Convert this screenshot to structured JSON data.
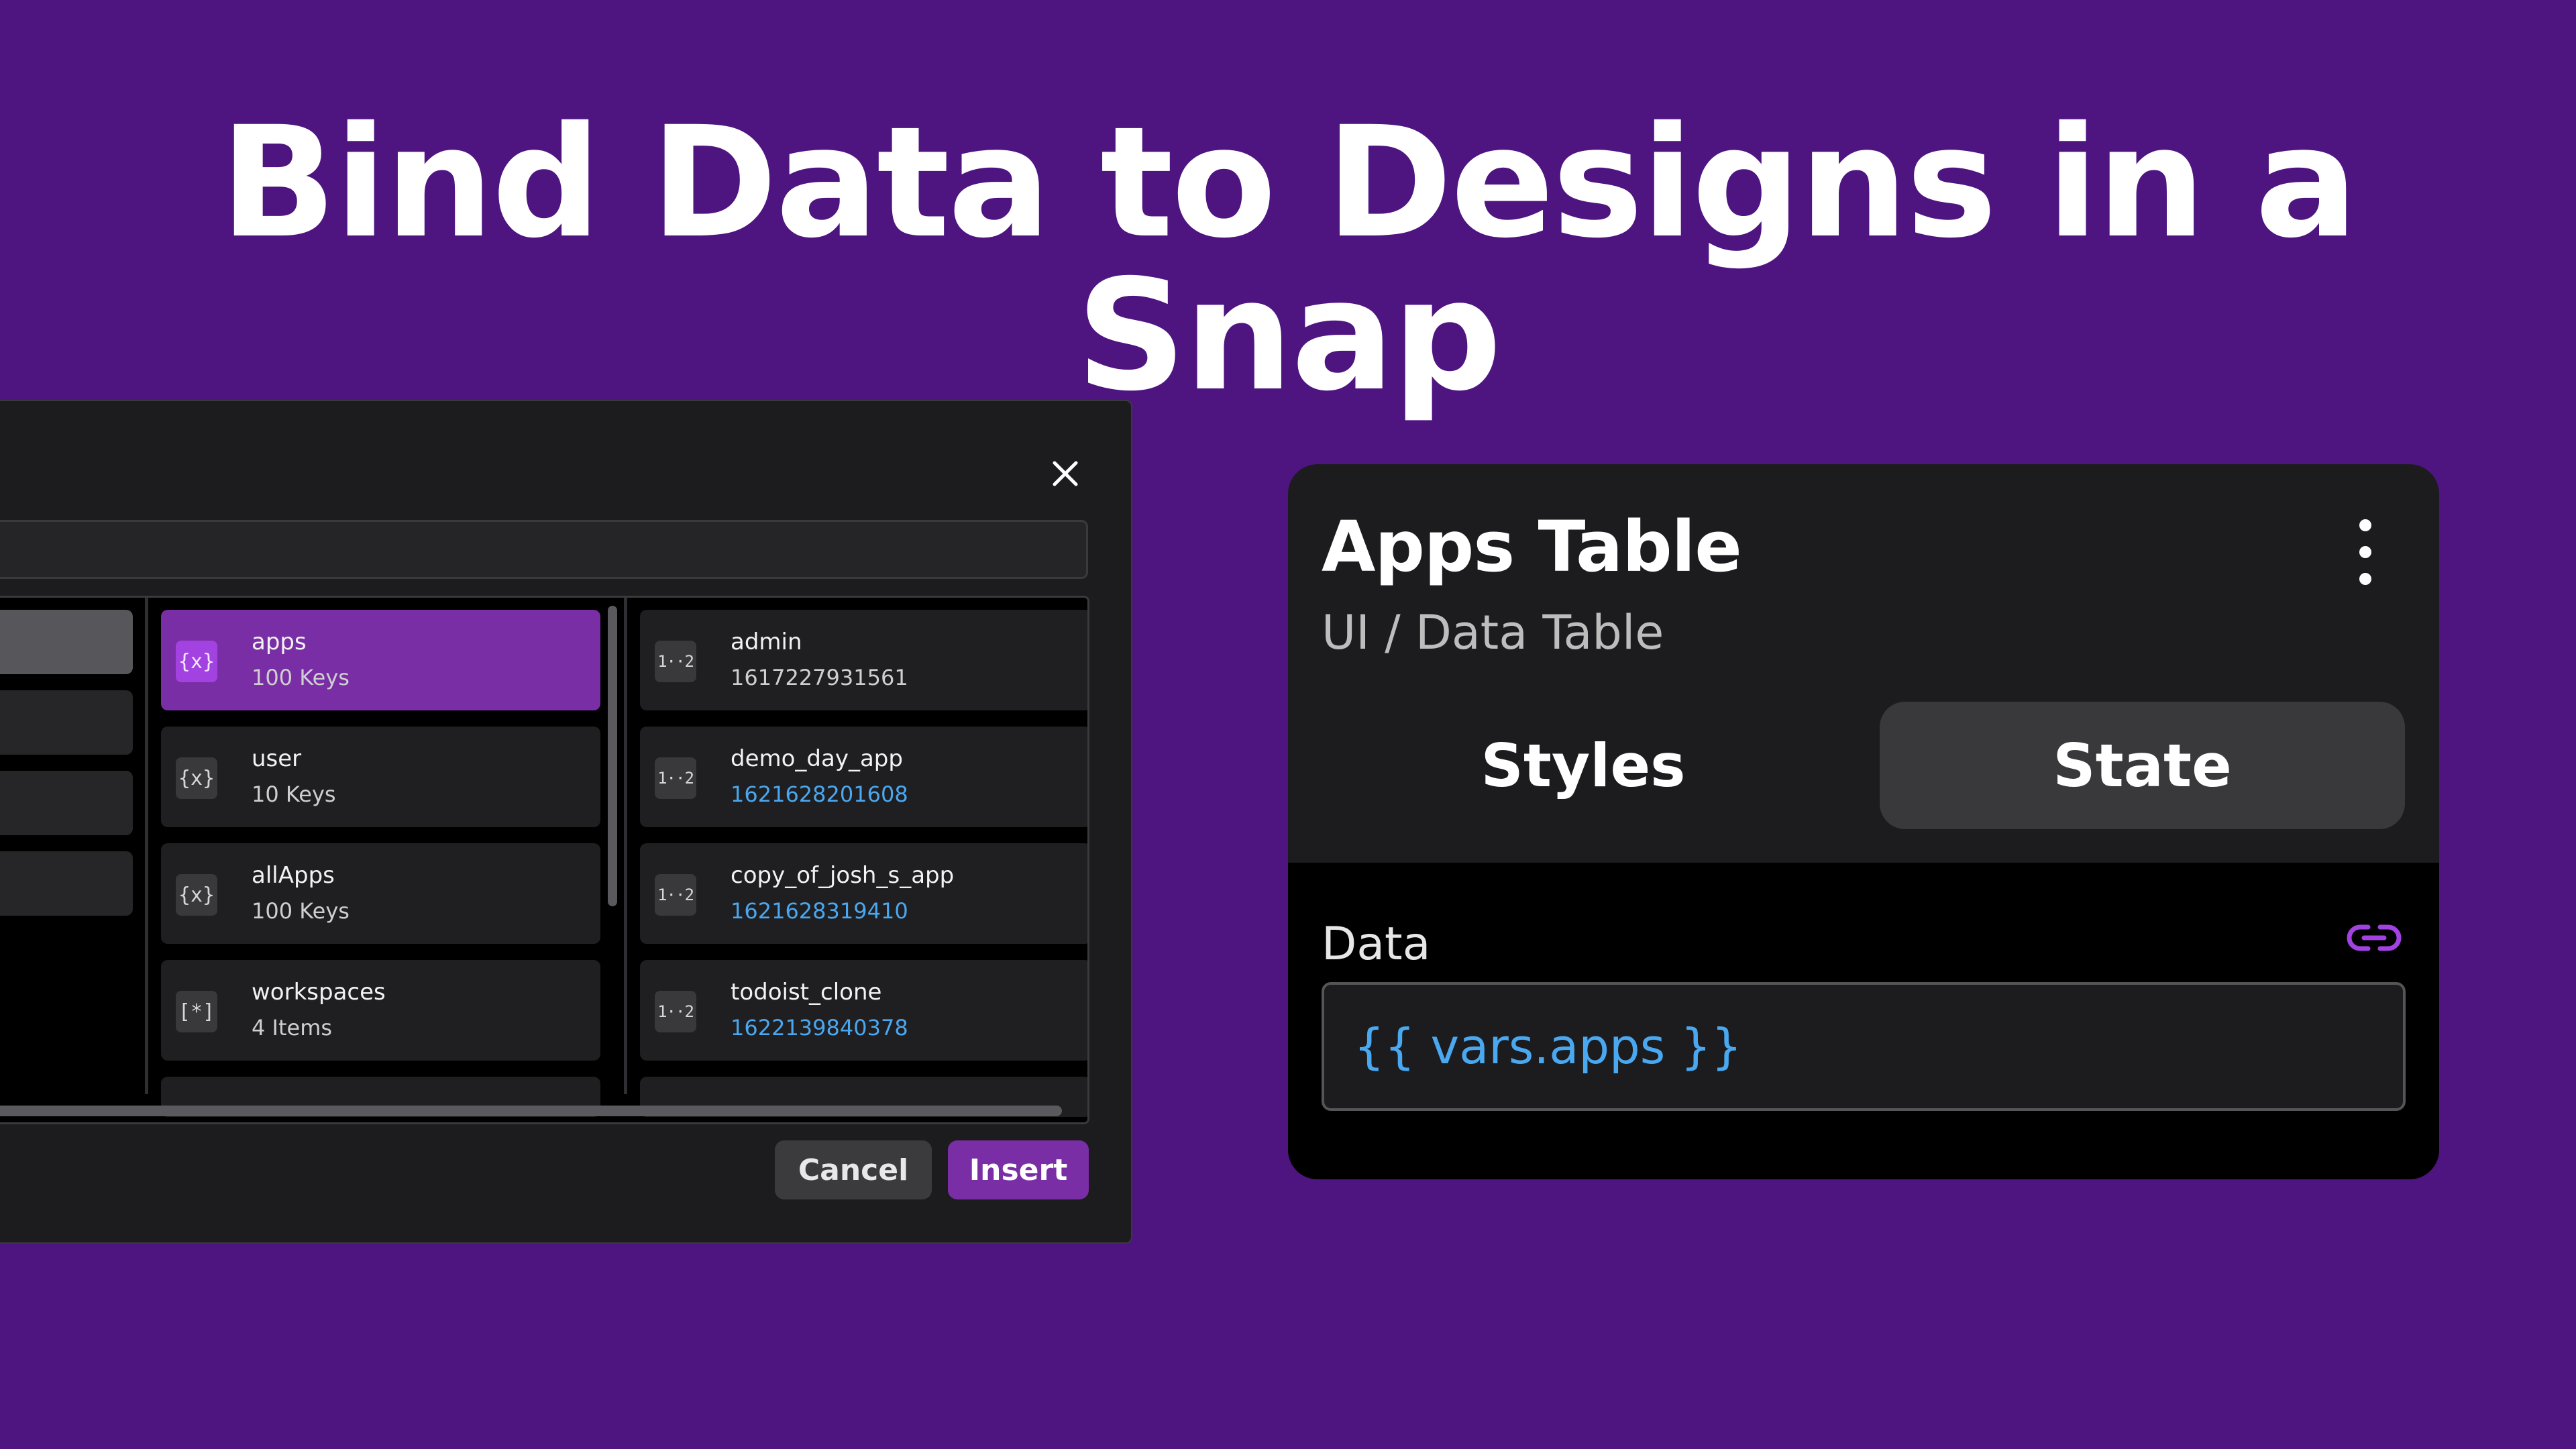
{
  "headline": "Bind Data to Designs in a Snap",
  "modal": {
    "close_icon": "close-icon",
    "middle_column": [
      {
        "title": "apps",
        "subtitle": "100 Keys",
        "icon": "{x}",
        "icon_name": "object-variable-icon",
        "selected": true
      },
      {
        "title": "user",
        "subtitle": "10 Keys",
        "icon": "{x}",
        "icon_name": "object-variable-icon",
        "selected": false
      },
      {
        "title": "allApps",
        "subtitle": "100 Keys",
        "icon": "{x}",
        "icon_name": "object-variable-icon",
        "selected": false
      },
      {
        "title": "workspaces",
        "subtitle": "4 Items",
        "icon": "[*]",
        "icon_name": "array-variable-icon",
        "selected": false
      }
    ],
    "right_column": [
      {
        "title": "admin",
        "subtitle": "1617227931561",
        "icon": "1··2",
        "icon_name": "number-icon",
        "link": false
      },
      {
        "title": "demo_day_app",
        "subtitle": "1621628201608",
        "icon": "1··2",
        "icon_name": "number-icon",
        "link": true
      },
      {
        "title": "copy_of_josh_s_app",
        "subtitle": "1621628319410",
        "icon": "1··2",
        "icon_name": "number-icon",
        "link": true
      },
      {
        "title": "todoist_clone",
        "subtitle": "1622139840378",
        "icon": "1··2",
        "icon_name": "number-icon",
        "link": true
      }
    ],
    "cancel_label": "Cancel",
    "insert_label": "Insert"
  },
  "panel": {
    "title": "Apps Table",
    "subtitle": "UI / Data Table",
    "tabs": [
      {
        "label": "Styles",
        "active": false
      },
      {
        "label": "State",
        "active": true
      }
    ],
    "data_label": "Data",
    "data_value": "{{ vars.apps }}",
    "link_icon": "link-icon",
    "more_icon": "kebab-menu-icon"
  },
  "colors": {
    "background": "#4e1581",
    "accent": "#7a2ea5",
    "link": "#4aa8f0",
    "panel": "#1c1c1e"
  }
}
